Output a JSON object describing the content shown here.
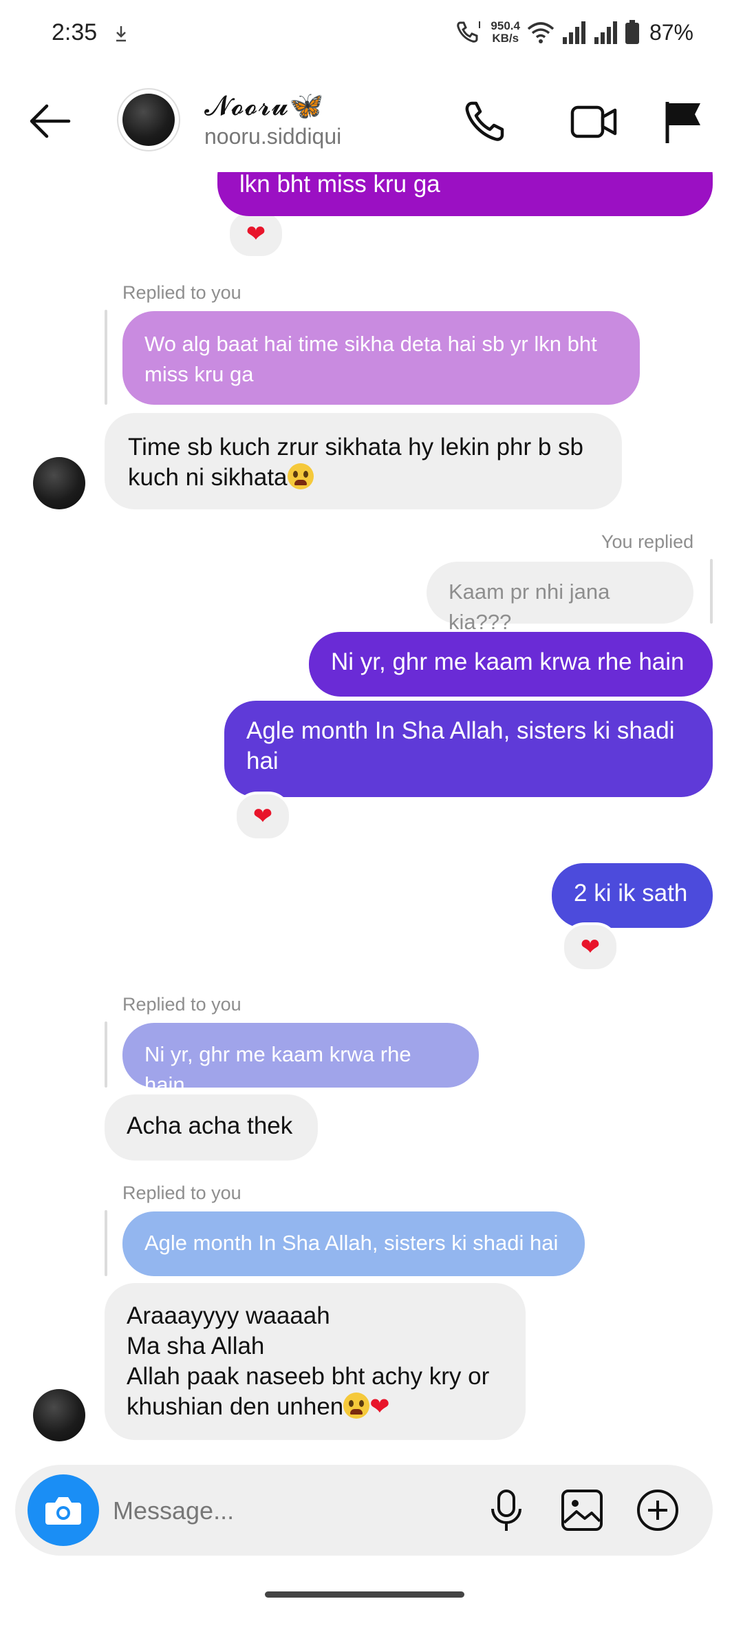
{
  "status_bar": {
    "time": "2:35",
    "speed_value": "950.4",
    "speed_unit": "KB/s",
    "battery": "87%"
  },
  "header": {
    "display_name": "𝓝𝓸𝓸𝓻𝓾🦋",
    "username": "nooru.siddiqui"
  },
  "messages": {
    "m1_text": "lkn bht miss kru ga",
    "reply1_label": "Replied to you",
    "reply1_quote": "Wo alg baat hai time sikha deta hai sb yr lkn bht miss kru ga",
    "m2_text": "Time sb kuch zrur sikhata hy lekin phr b sb kuch ni sikhata",
    "you_replied_label": "You replied",
    "you_replied_quote": "Kaam pr nhi jana kia???",
    "m3_text": "Ni yr, ghr me kaam krwa rhe hain",
    "m4_text": "Agle month In Sha Allah, sisters ki shadi hai",
    "m5_text": "2 ki ik sath",
    "reply2_label": "Replied to you",
    "reply2_quote": "Ni yr, ghr me kaam krwa rhe hain",
    "m6_text": "Acha acha thek",
    "reply3_label": "Replied to you",
    "reply3_quote": "Agle month In Sha Allah, sisters ki shadi hai",
    "m7_line1": "Araaayyyy waaaah",
    "m7_line2": "Ma sha Allah",
    "m7_line3": "Allah paak naseeb bht achy kry or",
    "m7_line4": "khushian den unhen",
    "reaction": "❤"
  },
  "composer": {
    "placeholder": "Message..."
  },
  "colors": {
    "gradient_purple": "#9b10c3",
    "gradient_violet": "#6a2bd6",
    "gradient_blue": "#4c4bdc",
    "incoming_bg": "#efefef",
    "camera_blue": "#1a8ef5"
  },
  "icons": [
    "download-icon",
    "call-status-icon",
    "wifi-icon",
    "signal-icon",
    "battery-icon",
    "back-arrow-icon",
    "phone-icon",
    "video-icon",
    "flag-icon",
    "camera-icon",
    "mic-icon",
    "gallery-icon",
    "plus-icon",
    "heart-icon"
  ]
}
